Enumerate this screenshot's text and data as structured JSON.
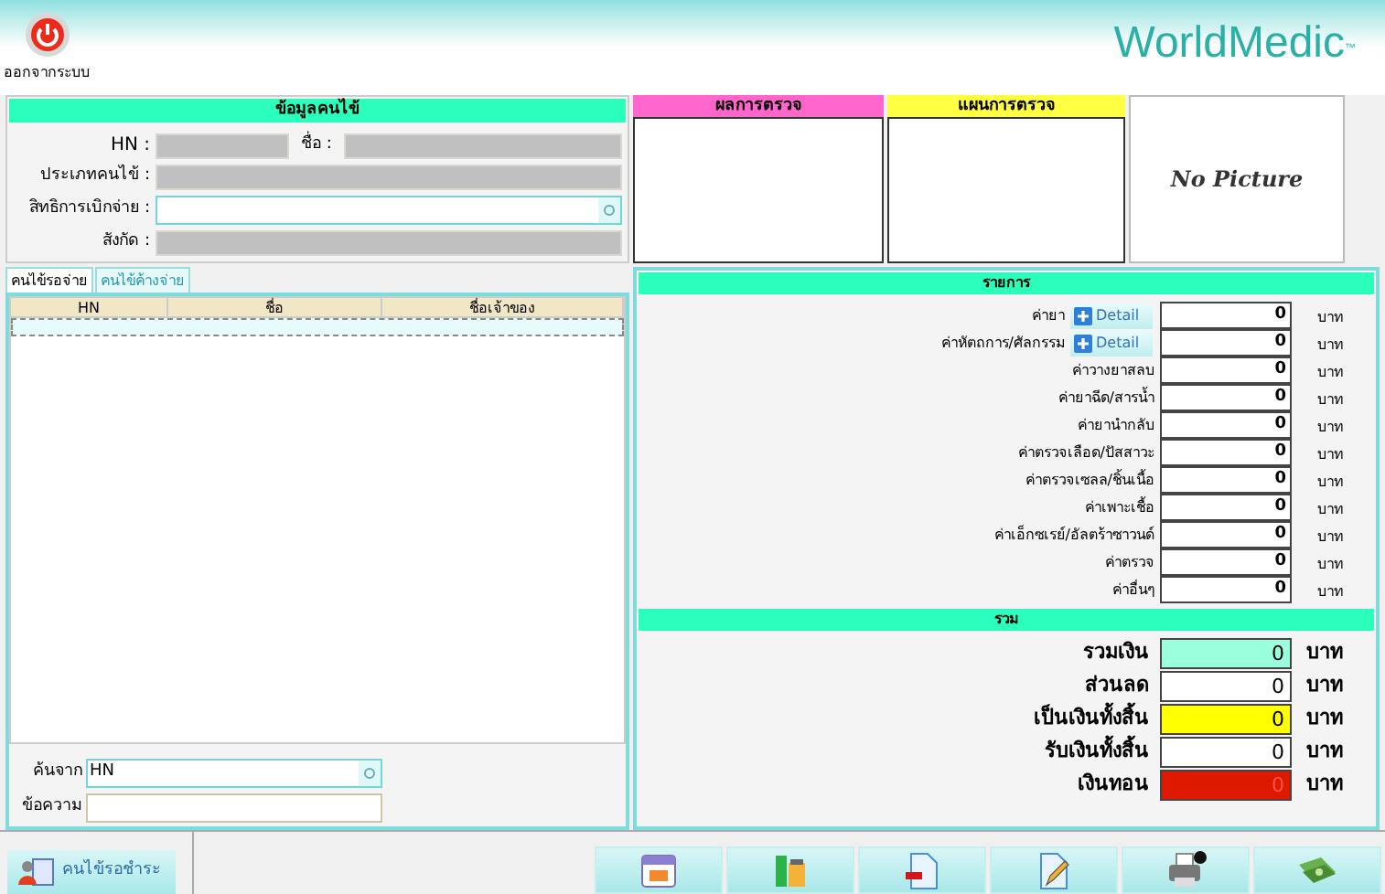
{
  "header": {
    "logout_label": "ออกจากระบบ",
    "logo": "WorldMedic",
    "logo_mark": "™"
  },
  "patient": {
    "title": "ข้อมูลคนไข้",
    "hn_label": "HN :",
    "name_label": "ชื่อ :",
    "type_label": "ประเภทคนไข้ :",
    "rights_label": "สิทธิการเบิกจ่าย :",
    "affiliation_label": "สังกัด :"
  },
  "results": {
    "title": "ผลการตรวจ"
  },
  "plan": {
    "title": "แผนการตรวจ"
  },
  "photo": {
    "text": "No Picture"
  },
  "tabs": [
    {
      "label": "คนไข้รอจ่าย",
      "selected": true
    },
    {
      "label": "คนไข้ค้างจ่าย",
      "selected": false
    }
  ],
  "table": {
    "columns": [
      "HN",
      "ชื่อ",
      "ชื่อเจ้าของ"
    ]
  },
  "search": {
    "by_label": "ค้นจาก",
    "by_value": "HN",
    "text_label": "ข้อความ"
  },
  "items": {
    "title": "รายการ",
    "rows": [
      {
        "label": "ค่ายา",
        "detail": "Detail",
        "value": "0",
        "unit": "บาท"
      },
      {
        "label": "ค่าหัตถการ/ศัลกรรม",
        "detail": "Detail",
        "value": "0",
        "unit": "บาท"
      },
      {
        "label": "ค่าวางยาสลบ",
        "value": "0",
        "unit": "บาท"
      },
      {
        "label": "ค่ายาฉีด/สารน้ำ",
        "value": "0",
        "unit": "บาท"
      },
      {
        "label": "ค่ายานำกลับ",
        "value": "0",
        "unit": "บาท"
      },
      {
        "label": "ค่าตรวจเลือด/ปัสสาวะ",
        "value": "0",
        "unit": "บาท"
      },
      {
        "label": "ค่าตรวจเซลล/ชิ้นเนื้อ",
        "value": "0",
        "unit": "บาท"
      },
      {
        "label": "ค่าเพาะเชื้อ",
        "value": "0",
        "unit": "บาท"
      },
      {
        "label": "ค่าเอ็กซเรย์/อัลตร้าซาวนด์",
        "value": "0",
        "unit": "บาท"
      },
      {
        "label": "ค่าตรวจ",
        "value": "0",
        "unit": "บาท"
      },
      {
        "label": "ค่าอื่นๆ",
        "value": "0",
        "unit": "บาท"
      }
    ]
  },
  "totals": {
    "title": "รวม",
    "rows": [
      {
        "label": "รวมเงิน",
        "value": "0",
        "unit": "บาท",
        "color": "#99ffdd"
      },
      {
        "label": "ส่วนลด",
        "value": "0",
        "unit": "บาท",
        "color": "#ffffff"
      },
      {
        "label": "เป็นเงินทั้งสิ้น",
        "value": "0",
        "unit": "บาท",
        "color": "#ffff00"
      },
      {
        "label": "รับเงินทั้งสิ้น",
        "value": "0",
        "unit": "บาท",
        "color": "#ffffff"
      },
      {
        "label": "เงินทอน",
        "value": "0",
        "unit": "บาท",
        "color": "#dd1a00"
      }
    ]
  },
  "footer": {
    "waiting_button": "คนไข้รอชำระ",
    "tools": [
      {
        "kind": "calendar"
      },
      {
        "kind": "bottles"
      },
      {
        "kind": "remove"
      },
      {
        "kind": "edit"
      },
      {
        "kind": "print"
      },
      {
        "kind": "money"
      }
    ]
  }
}
